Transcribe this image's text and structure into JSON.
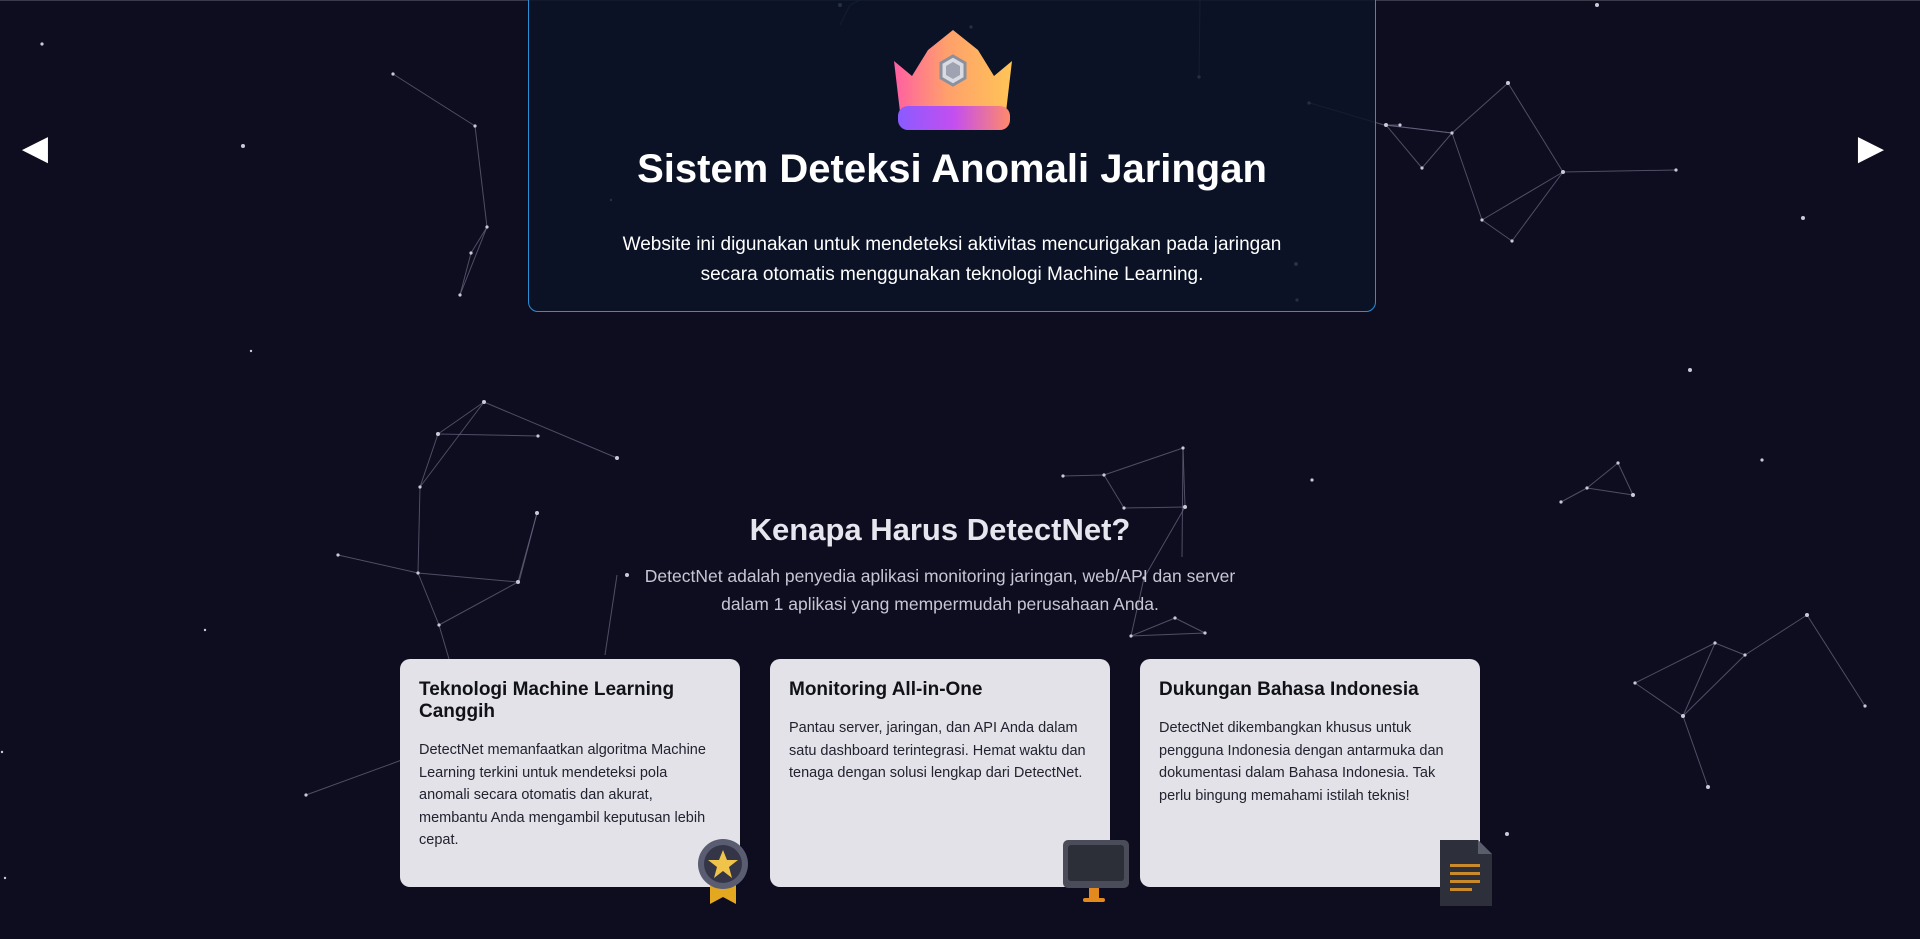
{
  "nav": {
    "prev_label": "◀",
    "next_label": "▶"
  },
  "hero": {
    "title": "Sistem Deteksi Anomali Jaringan",
    "description": "Website ini digunakan untuk mendeteksi aktivitas mencurigakan pada jaringan secara otomatis menggunakan teknologi Machine Learning.",
    "icon": "crown-icon",
    "border_color": "#2b8fd6"
  },
  "why": {
    "title": "Kenapa Harus DetectNet?",
    "description": "DetectNet adalah penyedia aplikasi monitoring jaringan, web/API dan server dalam 1 aplikasi yang mempermudah perusahaan Anda."
  },
  "features": [
    {
      "title": "Teknologi Machine Learning Canggih",
      "description": "DetectNet memanfaatkan algoritma Machine Learning terkini untuk mendeteksi pola anomali secara otomatis dan akurat, membantu Anda mengambil keputusan lebih cepat.",
      "icon": "medal-icon"
    },
    {
      "title": "Monitoring All-in-One",
      "description": "Pantau server, jaringan, dan API Anda dalam satu dashboard terintegrasi. Hemat waktu dan tenaga dengan solusi lengkap dari DetectNet.",
      "icon": "monitor-icon"
    },
    {
      "title": "Dukungan Bahasa Indonesia",
      "description": "DetectNet dikembangkan khusus untuk pengguna Indonesia dengan antarmuka dan dokumentasi dalam Bahasa Indonesia. Tak perlu bingung memahami istilah teknis!",
      "icon": "document-icon"
    }
  ],
  "colors": {
    "background": "#0e0c1f",
    "card_background": "#e2e2e8"
  }
}
